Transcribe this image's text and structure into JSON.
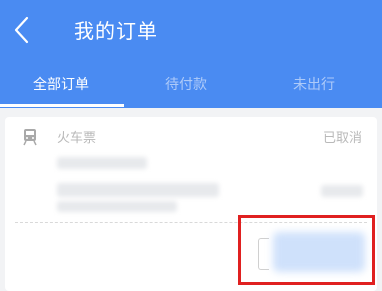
{
  "header": {
    "title": "我的订单",
    "back_icon": "chevron-left-icon"
  },
  "tabs": [
    {
      "label": "全部订单",
      "active": true
    },
    {
      "label": "待付款",
      "active": false
    },
    {
      "label": "未出行",
      "active": false
    }
  ],
  "order": {
    "type_icon": "train-icon",
    "type": "火车票",
    "status": "已取消"
  },
  "colors": {
    "brand": "#4a8bf2",
    "highlight": "#e02020"
  }
}
